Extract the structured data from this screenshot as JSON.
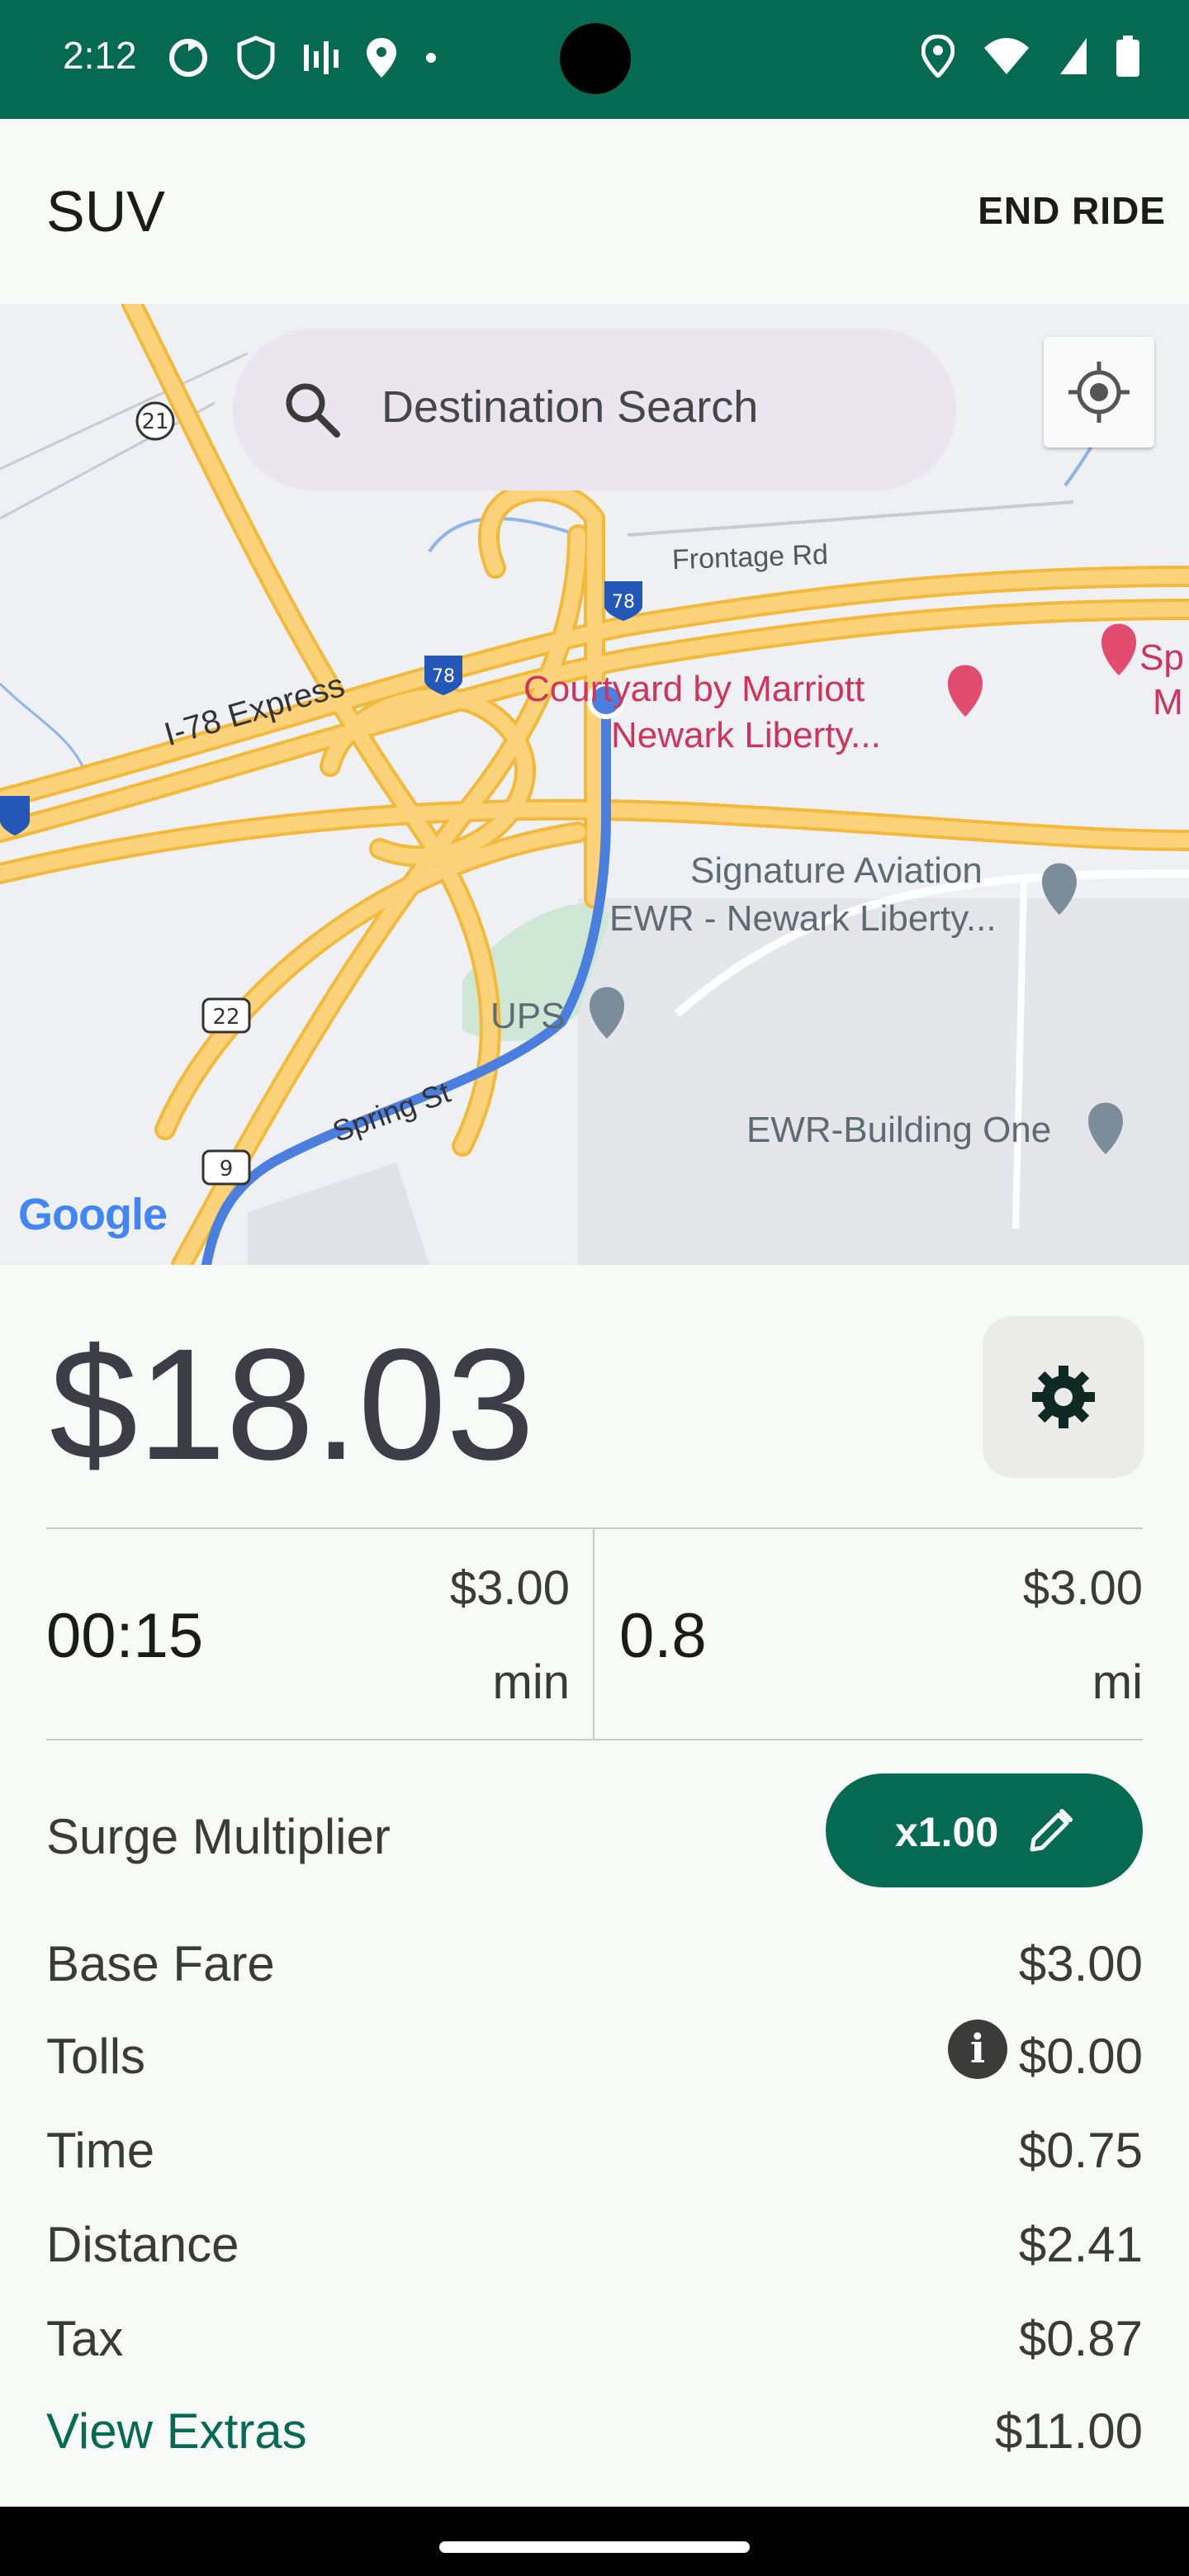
{
  "status_bar": {
    "time": "2:12"
  },
  "app_bar": {
    "title": "SUV",
    "end_ride_label": "END RIDE"
  },
  "map": {
    "search_placeholder": "Destination Search",
    "labels": {
      "frontage": "Frontage Rd",
      "i78_express": "I-78 Express",
      "courtyard": "Courtyard by Marriott",
      "courtyard2": "Newark Liberty...",
      "signature": "Signature Aviation",
      "ewr": "EWR - Newark Liberty...",
      "ups": "UPS",
      "spring": "Spring St",
      "building": "EWR-Building One",
      "partial_sp": "Sp",
      "partial_m": "M"
    },
    "shields": {
      "r21": "21",
      "r22": "22",
      "r9": "9",
      "r78": "78"
    },
    "attribution": "Google"
  },
  "fare": {
    "total": "$18.03"
  },
  "stats": {
    "time": {
      "value": "00:15",
      "rate": "$3.00",
      "unit": "min"
    },
    "distance": {
      "value": "0.8",
      "rate": "$3.00",
      "unit": "mi"
    }
  },
  "surge": {
    "label": "Surge Multiplier",
    "value": "x1.00"
  },
  "breakdown": [
    {
      "label": "Base Fare",
      "value": "$3.00"
    },
    {
      "label": "Tolls",
      "value": "$0.00"
    },
    {
      "label": "Time",
      "value": "$0.75"
    },
    {
      "label": "Distance",
      "value": "$2.41"
    },
    {
      "label": "Tax",
      "value": "$0.87"
    },
    {
      "label": "View Extras",
      "value": "$11.00"
    }
  ],
  "colors": {
    "accent": "#046b52",
    "highway": "#fcd27a",
    "route": "#4a7fe0"
  }
}
